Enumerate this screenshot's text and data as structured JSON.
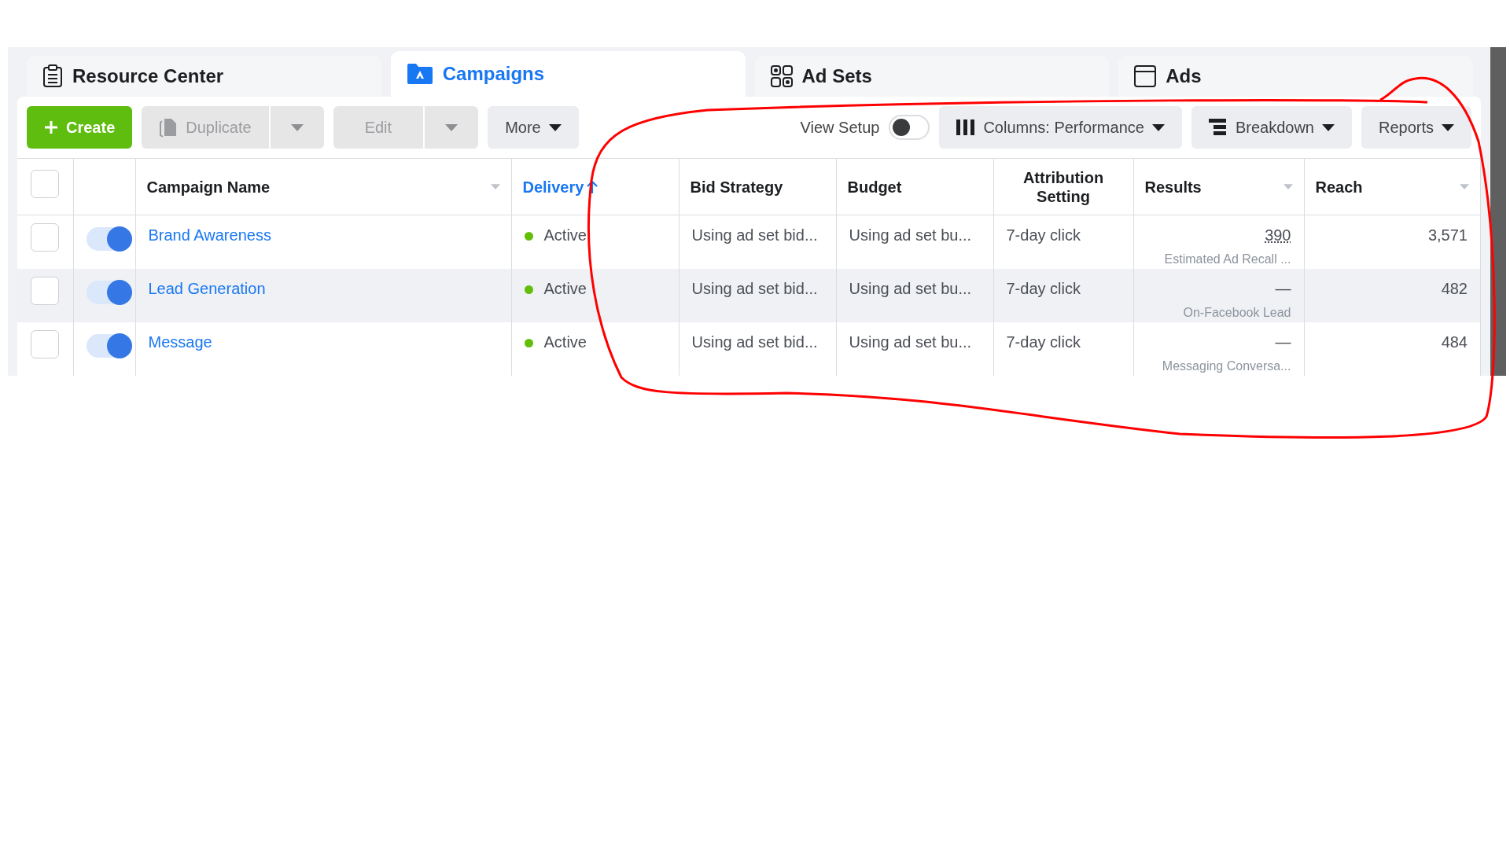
{
  "tabs": [
    {
      "label": "Resource Center",
      "selected": false
    },
    {
      "label": "Campaigns",
      "selected": true
    },
    {
      "label": "Ad Sets",
      "selected": false
    },
    {
      "label": "Ads",
      "selected": false
    }
  ],
  "toolbar": {
    "left": [
      {
        "kind": "primary",
        "label": "Create",
        "disabled": false
      },
      {
        "kind": "split",
        "label": "Duplicate",
        "disabled": true
      },
      {
        "kind": "split",
        "label": "Edit",
        "disabled": true
      },
      {
        "kind": "menu",
        "label": "More",
        "disabled": false
      }
    ],
    "view_setup": {
      "label": "View Setup",
      "on": false
    },
    "right": [
      {
        "label": "Columns: Performance"
      },
      {
        "label": "Breakdown"
      },
      {
        "label": "Reports"
      }
    ]
  },
  "table": {
    "select_all": {
      "checked": false
    },
    "columns": [
      {
        "kind": "check"
      },
      {
        "kind": "toggle"
      },
      {
        "label": "Campaign Name",
        "sortable": true,
        "sorted": false
      },
      {
        "label": "Delivery",
        "sortable": false,
        "sorted": true
      },
      {
        "label": "Bid Strategy",
        "sortable": false,
        "sorted": false
      },
      {
        "label": "Budget",
        "sortable": false,
        "sorted": false
      },
      {
        "label": "Attribution Setting",
        "sortable": false,
        "sorted": false
      },
      {
        "label": "Results",
        "sortable": true,
        "sorted": false
      },
      {
        "label": "Reach",
        "sortable": true,
        "sorted": false
      }
    ],
    "rows": [
      {
        "checked": false,
        "on": true,
        "highlighted": false,
        "name": "Brand Awareness",
        "delivery": "Active",
        "color": "#63be09",
        "bid": "Using ad set bid...",
        "budget": "Using ad set bu...",
        "attribution": "7-day click",
        "result": "390",
        "result_label": "Estimated Ad Recall ...",
        "reach": "3,571"
      },
      {
        "checked": false,
        "on": true,
        "highlighted": true,
        "name": "Lead Generation",
        "delivery": "Active",
        "color": "#63be09",
        "bid": "Using ad set bid...",
        "budget": "Using ad set bu...",
        "attribution": "7-day click",
        "result": "—",
        "result_label": "On-Facebook Lead",
        "reach": "482"
      },
      {
        "checked": false,
        "on": true,
        "highlighted": false,
        "name": "Message",
        "delivery": "Active",
        "color": "#63be09",
        "bid": "Using ad set bid...",
        "budget": "Using ad set bu...",
        "attribution": "7-day click",
        "result": "—",
        "result_label": "Messaging Conversa...",
        "reach": "484"
      }
    ]
  }
}
